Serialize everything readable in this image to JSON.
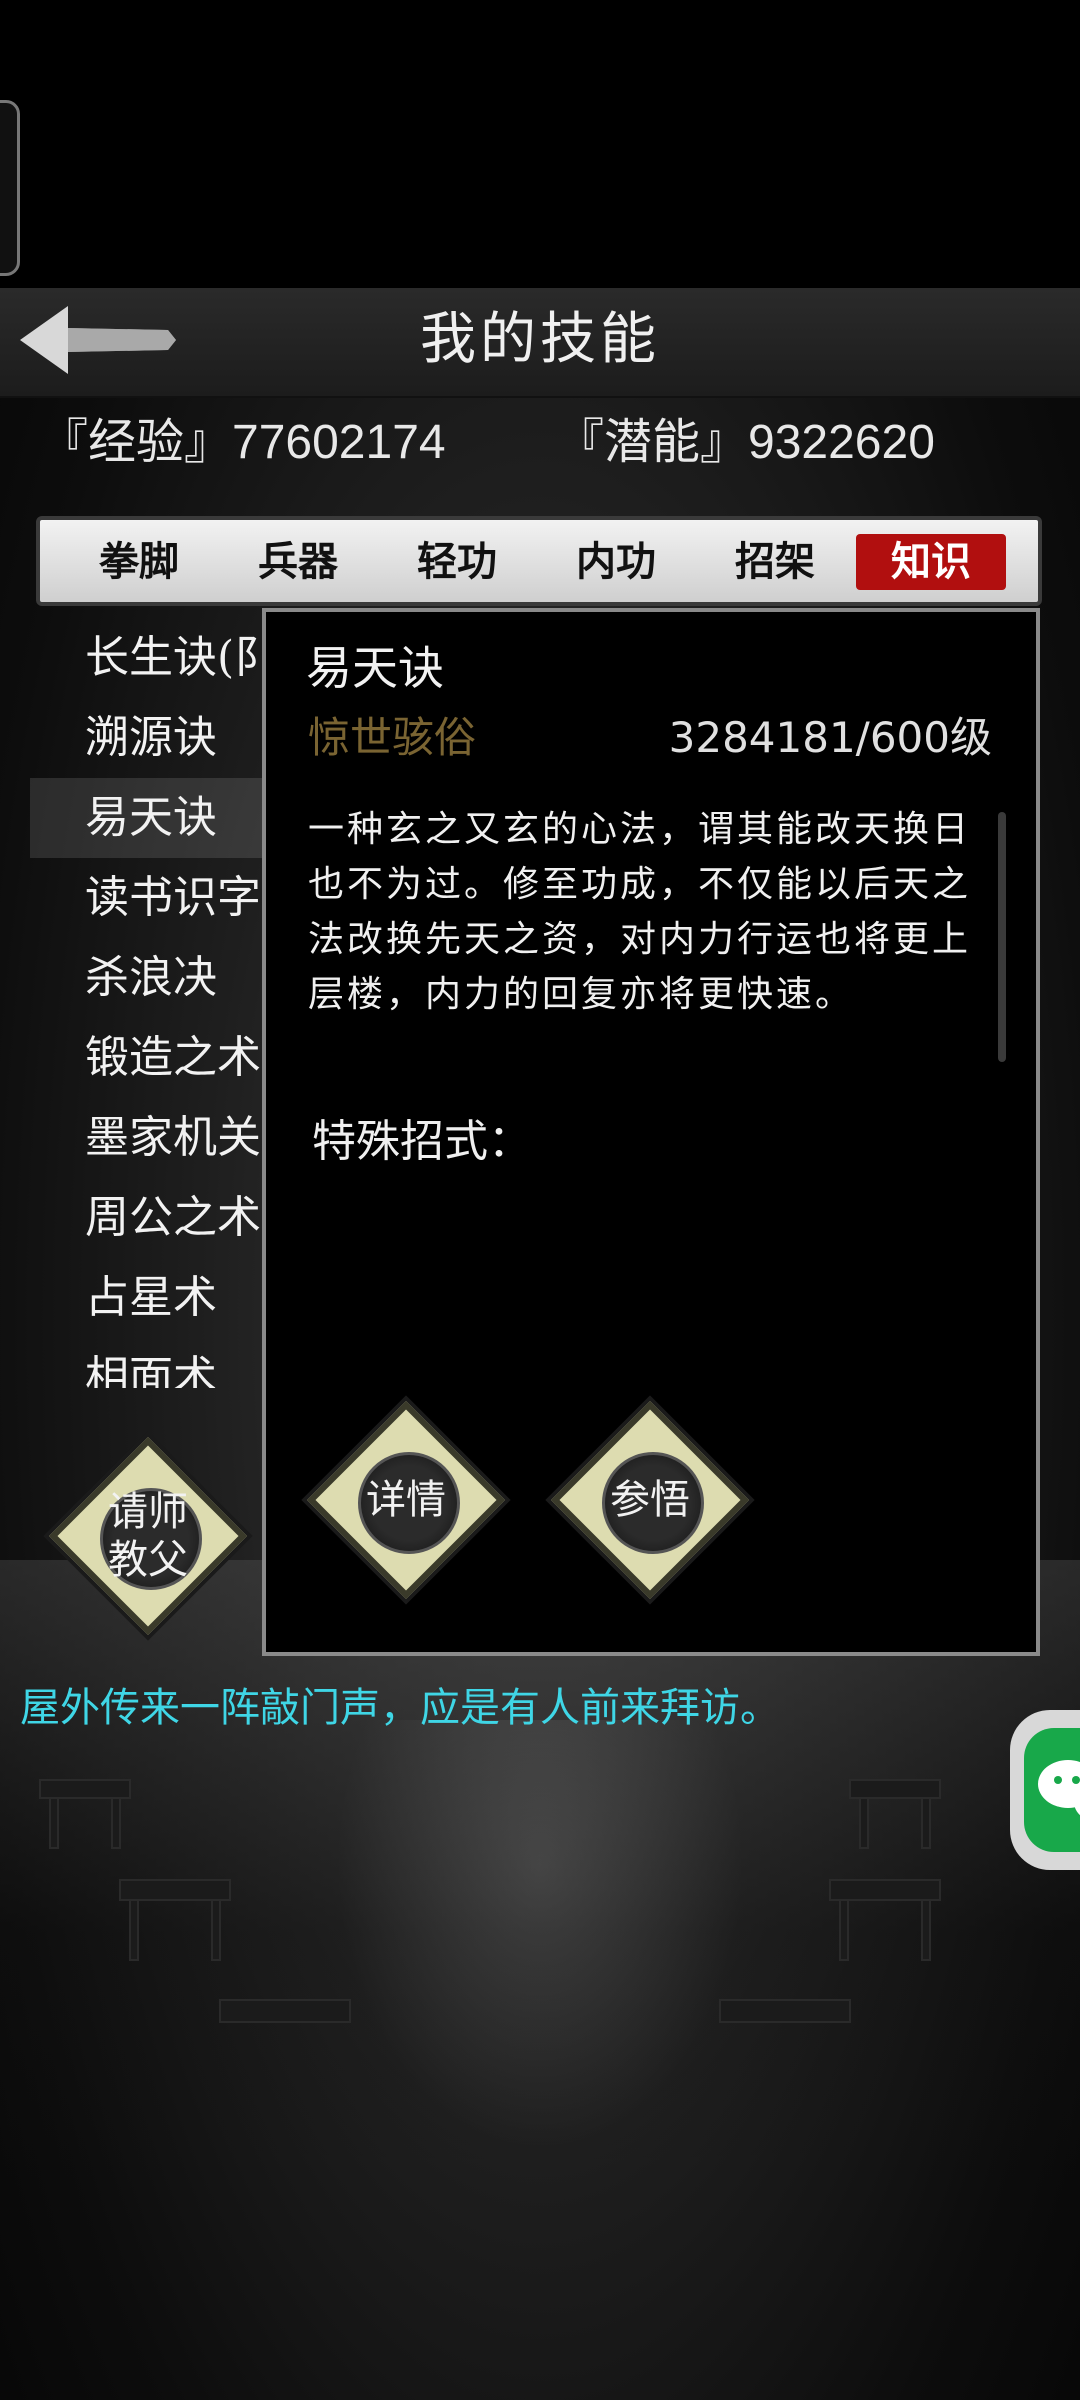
{
  "header": {
    "title": "我的技能",
    "back_icon": "back-arrow-icon"
  },
  "stats": {
    "exp_label": "『经验』",
    "exp_value": "77602174",
    "potential_label": "『潜能』",
    "potential_value": "9322620"
  },
  "tabs": [
    {
      "label": "拳脚",
      "active": false
    },
    {
      "label": "兵器",
      "active": false
    },
    {
      "label": "轻功",
      "active": false
    },
    {
      "label": "内功",
      "active": false
    },
    {
      "label": "招架",
      "active": false
    },
    {
      "label": "知识",
      "active": true
    }
  ],
  "skills": [
    {
      "name": "长生诀(阝"
    },
    {
      "name": "溯源诀"
    },
    {
      "name": "易天诀",
      "selected": true
    },
    {
      "name": "读书识字"
    },
    {
      "name": "杀浪决"
    },
    {
      "name": "锻造之术"
    },
    {
      "name": "墨家机关"
    },
    {
      "name": "周公之术"
    },
    {
      "name": "占星术"
    },
    {
      "name": "相面术"
    }
  ],
  "detail": {
    "title": "易天诀",
    "rank": "惊世骇俗",
    "level": "3284181/600级",
    "description": "一种玄之又玄的心法，谓其能改天换日也不为过。修至功成，不仅能以后天之法改换先天之资，对内力行运也将更上层楼，内力的回复亦将更快速。",
    "special_label": "特殊招式：",
    "detail_button": "详情",
    "comprehend_button": "参悟"
  },
  "teacher_button": {
    "line1": "请师",
    "line2": "教父"
  },
  "message": "屋外传来一阵敲门声，应是有人前来拜访。",
  "colors": {
    "active_tab": "#b10f0f",
    "rank_text": "#7a6432",
    "message_text": "#3fd6e6",
    "chat_green": "#18a84a"
  },
  "chat_icon": "chat-bubble-icon"
}
